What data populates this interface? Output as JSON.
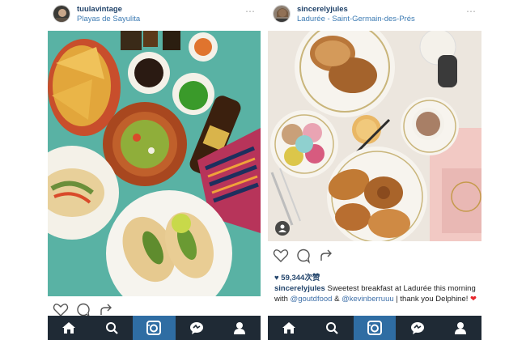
{
  "posts": [
    {
      "username": "tuulavintage",
      "location": "Playas de Sayulita"
    },
    {
      "username": "sincerelyjules",
      "location": "Ladurée - Saint-Germain-des-Prés",
      "likes": "59,344次赞",
      "caption": {
        "user": "sincerelyjules",
        "text_1": " Sweetest breakfast at Ladurée this morning with ",
        "mention_1": "@goutdfood",
        "text_2": " & ",
        "mention_2": "@kevinberruuu",
        "text_3": " | thank you Delphine! ",
        "emoji": "❤"
      }
    }
  ],
  "icons": {
    "more": "⋯"
  },
  "colors": {
    "username": "#22446b",
    "location": "#3d7bb3",
    "tabbar": "#1f2a35",
    "tab_active": "#2f6da3"
  }
}
